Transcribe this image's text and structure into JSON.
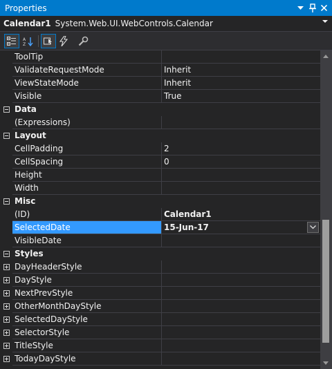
{
  "window": {
    "title": "Properties"
  },
  "object_selector": {
    "name": "Calendar1",
    "type": "System.Web.UI.WebControls.Calendar"
  },
  "toolbar": {
    "buttons": [
      "categorized",
      "alphabetical",
      "properties",
      "events",
      "property-pages"
    ]
  },
  "rows": [
    {
      "kind": "prop",
      "name": "ToolTip",
      "value": ""
    },
    {
      "kind": "prop",
      "name": "ValidateRequestMode",
      "value": "Inherit"
    },
    {
      "kind": "prop",
      "name": "ViewStateMode",
      "value": "Inherit"
    },
    {
      "kind": "prop",
      "name": "Visible",
      "value": "True"
    },
    {
      "kind": "cat",
      "name": "Data"
    },
    {
      "kind": "prop",
      "name": "(Expressions)",
      "value": ""
    },
    {
      "kind": "cat",
      "name": "Layout"
    },
    {
      "kind": "prop",
      "name": "CellPadding",
      "value": "2"
    },
    {
      "kind": "prop",
      "name": "CellSpacing",
      "value": "0"
    },
    {
      "kind": "prop",
      "name": "Height",
      "value": ""
    },
    {
      "kind": "prop",
      "name": "Width",
      "value": ""
    },
    {
      "kind": "cat",
      "name": "Misc"
    },
    {
      "kind": "prop",
      "name": "(ID)",
      "value": "Calendar1",
      "bold": true
    },
    {
      "kind": "prop",
      "name": "SelectedDate",
      "value": "15-Jun-17",
      "bold": true,
      "selected": true
    },
    {
      "kind": "prop",
      "name": "VisibleDate",
      "value": ""
    },
    {
      "kind": "cat",
      "name": "Styles"
    },
    {
      "kind": "expand",
      "name": "DayHeaderStyle",
      "value": ""
    },
    {
      "kind": "expand",
      "name": "DayStyle",
      "value": ""
    },
    {
      "kind": "expand",
      "name": "NextPrevStyle",
      "value": ""
    },
    {
      "kind": "expand",
      "name": "OtherMonthDayStyle",
      "value": ""
    },
    {
      "kind": "expand",
      "name": "SelectedDayStyle",
      "value": ""
    },
    {
      "kind": "expand",
      "name": "SelectorStyle",
      "value": ""
    },
    {
      "kind": "expand",
      "name": "TitleStyle",
      "value": ""
    },
    {
      "kind": "expand",
      "name": "TodayDayStyle",
      "value": ""
    }
  ],
  "colors": {
    "accent": "#007acc",
    "selection": "#3399ff",
    "background": "#252526",
    "text": "#f1f1f1"
  }
}
